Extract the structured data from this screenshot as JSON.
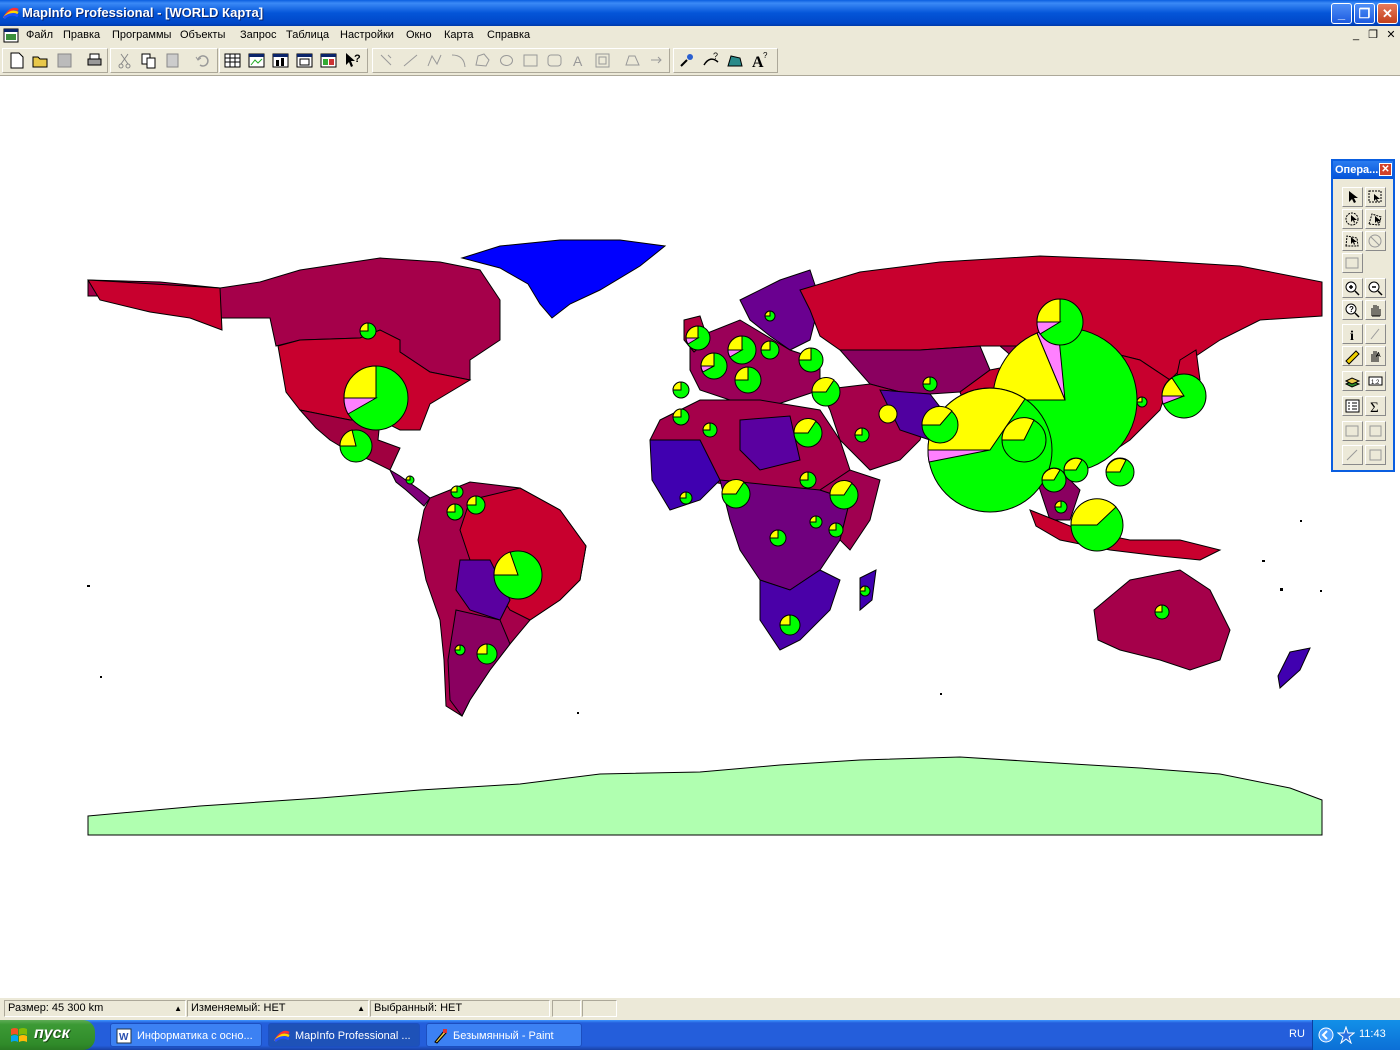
{
  "window": {
    "title": "MapInfo Professional - [WORLD Карта]",
    "buttons": {
      "minimize": "_",
      "maximize": "❐",
      "close": "✕"
    }
  },
  "menu": {
    "items": [
      "Файл",
      "Правка",
      "Программы",
      "Объекты",
      "Запрос",
      "Таблица",
      "Настройки",
      "Окно",
      "Карта",
      "Справка"
    ],
    "mdi_buttons": [
      "_",
      "❐",
      "✕"
    ]
  },
  "toolbar": {
    "icons": [
      "new-icon",
      "open-icon",
      "save-icon",
      "print-icon",
      "cut-icon",
      "copy-icon",
      "paste-icon",
      "undo-icon",
      "browser-icon",
      "map-window-icon",
      "graph-icon",
      "layout-icon",
      "redistricter-icon",
      "help-pointer-icon",
      "reshape-icon",
      "line-icon",
      "polyline-icon",
      "arc-icon",
      "polygon-icon",
      "ellipse-icon",
      "rectangle-icon",
      "rounded-rect-icon",
      "text-icon",
      "frame-icon",
      "add-node-icon",
      "symbol-style-icon",
      "tool-pointer-icon",
      "line-style-icon",
      "region-style-icon",
      "text-style-icon"
    ]
  },
  "palette": {
    "title": "Опера...",
    "close": "✕",
    "icons": [
      "select-icon",
      "marquee-select-icon",
      "radius-select-icon",
      "polygon-select-icon",
      "boundary-select-icon",
      "unselect-icon",
      "graph-select-icon",
      "zoom-in-icon",
      "zoom-out-icon",
      "change-view-icon",
      "grabber-icon",
      "info-icon",
      "hotlink-icon",
      "ruler-icon",
      "drag-window-icon",
      "layer-control-icon",
      "label-icon",
      "legend-icon",
      "statistics-icon",
      "clip-region-icon",
      "set-target-icon",
      "drag-map-icon",
      "show-hide-icon"
    ]
  },
  "colors": {
    "ocean": "#ffffff",
    "antarctica": "#b0ffb0",
    "greenland": "#0000ff",
    "pie_green": "#00ff00",
    "pie_yellow": "#ffff00",
    "pie_pink": "#ff80ff",
    "country_red": "#c8002e",
    "country_crimson": "#a50046",
    "country_purple": "#70007e",
    "country_violet": "#4000b0"
  },
  "statusbar": {
    "size": "Размер: 45 300 km",
    "editable": "Изменяемый: НЕТ",
    "selected": "Выбранный: НЕТ"
  },
  "taskbar": {
    "start_label": "пуск",
    "tasks": [
      "Информатика с осно...",
      "MapInfo Professional ...",
      "Безымянный - Paint"
    ],
    "lang": "RU",
    "clock": "11:43"
  }
}
